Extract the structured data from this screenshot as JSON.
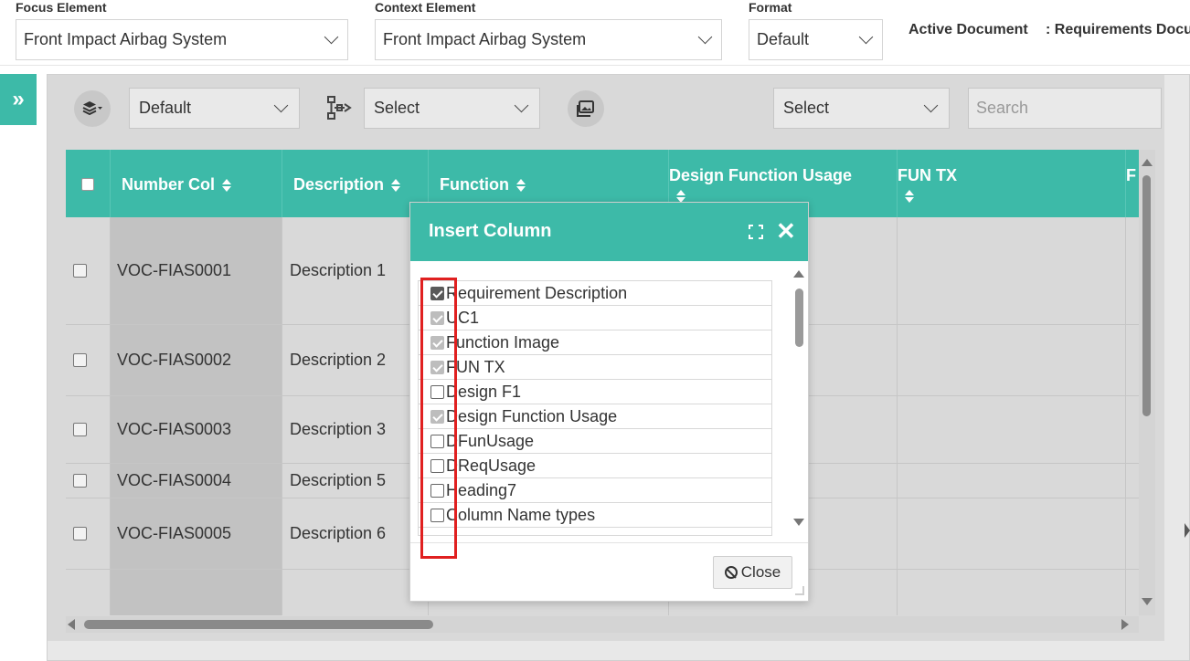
{
  "topbar": {
    "focus_label": "Focus Element",
    "focus_value": "Front Impact Airbag System",
    "context_label": "Context Element",
    "context_value": "Front Impact Airbag System",
    "format_label": "Format",
    "format_value": "Default",
    "active_doc_label": "Active Document",
    "active_doc_value": ": Requirements Docu"
  },
  "toolbar": {
    "layer_select": "Default",
    "hierarchy_select": "Select",
    "right_select": "Select",
    "search_placeholder": "Search"
  },
  "table": {
    "headers": [
      "Number Col",
      "Description",
      "Function",
      "Design Function Usage",
      "FUN TX",
      "F"
    ],
    "rows": [
      {
        "number": "VOC-FIAS0001",
        "description": "Description 1"
      },
      {
        "number": "VOC-FIAS0002",
        "description": "Description 2"
      },
      {
        "number": "VOC-FIAS0003",
        "description": "Description 3"
      },
      {
        "number": "VOC-FIAS0004",
        "description": "Description 5"
      },
      {
        "number": "VOC-FIAS0005",
        "description": "Description 6"
      }
    ]
  },
  "modal": {
    "title": "Insert Column",
    "items": [
      {
        "label": "Requirement Description",
        "state": "checked"
      },
      {
        "label": "UC1",
        "state": "disabled"
      },
      {
        "label": "Function Image",
        "state": "disabled"
      },
      {
        "label": "FUN TX",
        "state": "disabled"
      },
      {
        "label": "Design F1",
        "state": "unchecked"
      },
      {
        "label": "Design Function Usage",
        "state": "disabled"
      },
      {
        "label": "DFunUsage",
        "state": "unchecked"
      },
      {
        "label": "DReqUsage",
        "state": "unchecked"
      },
      {
        "label": "Heading7",
        "state": "unchecked"
      },
      {
        "label": "Column Name types",
        "state": "unchecked"
      }
    ],
    "close_label": "Close"
  },
  "colors": {
    "accent": "#3dbaa8",
    "highlight": "#e02020"
  }
}
